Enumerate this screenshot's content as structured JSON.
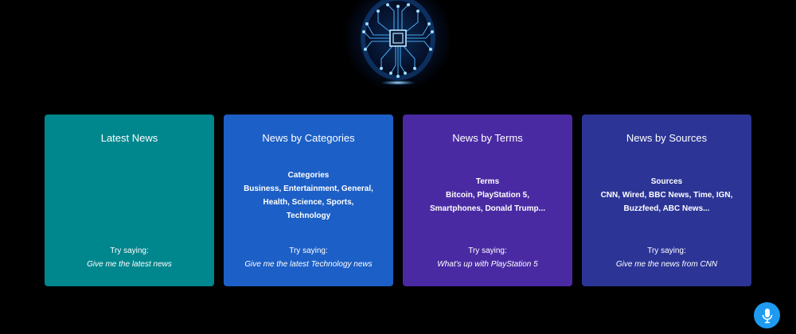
{
  "cards": [
    {
      "title": "Latest News",
      "color": "#00868d",
      "info_heading": "",
      "info_lines": [],
      "try_label": "Try saying:",
      "example": "Give me the latest news"
    },
    {
      "title": "News by Categories",
      "color": "#1c5fc6",
      "info_heading": "Categories",
      "info_lines": [
        "Business, Entertainment, General,",
        "Health, Science, Sports,",
        "Technology"
      ],
      "try_label": "Try saying:",
      "example": "Give me the latest Technology news"
    },
    {
      "title": "News by Terms",
      "color": "#4a2aa3",
      "info_heading": "Terms",
      "info_lines": [
        "Bitcoin, PlayStation 5,",
        "Smartphones, Donald Trump..."
      ],
      "try_label": "Try saying:",
      "example": "What's up with PlayStation 5"
    },
    {
      "title": "News by Sources",
      "color": "#2c3596",
      "info_heading": "Sources",
      "info_lines": [
        "CNN, Wired, BBC News, Time, IGN,",
        "Buzzfeed, ABC News..."
      ],
      "try_label": "Try saying:",
      "example": "Give me the news from CNN"
    }
  ],
  "logo": {
    "icon": "ai-brain-chip-icon",
    "glow_color": "#3aa8ff"
  },
  "mic_button": {
    "icon": "microphone-icon",
    "color": "#1e9bf0"
  }
}
